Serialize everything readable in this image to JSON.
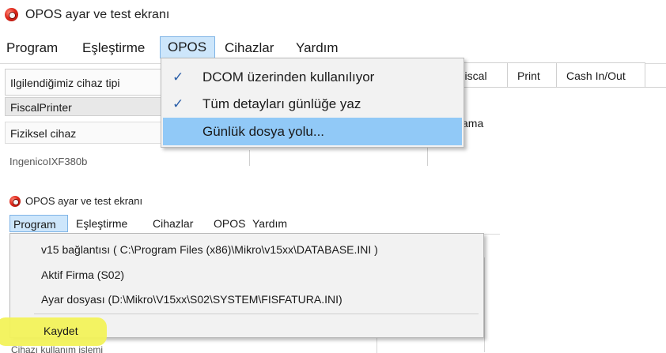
{
  "screenshot_top": {
    "window_title": "OPOS ayar ve test ekranı",
    "menubar": [
      "Program",
      "Eşleştirme",
      "OPOS",
      "Cihazlar",
      "Yardım"
    ],
    "open_menu": "OPOS",
    "dropdown": {
      "item1": "DCOM üzerinden kullanılıyor",
      "item1_checked": true,
      "item2": "Tüm detayları günlüğe yaz",
      "item2_checked": true,
      "item3": "Günlük dosya yolu...",
      "item3_highlighted": true,
      "check_glyph": "✓"
    },
    "left_panel": {
      "device_type_label": "Ilgilendiğimiz cihaz tipi",
      "device_type_value": "FiscalPrinter",
      "physical_device_label": "Fiziksel cihaz",
      "physical_device_value_cut": "IngenicoIXF380b"
    },
    "tabs": [
      "Fiscal",
      "Print",
      "Cash In/Out"
    ],
    "right_fragment": "ama"
  },
  "screenshot_bottom": {
    "window_title": "OPOS ayar ve test ekranı",
    "menubar": [
      "Program",
      "Eşleştirme",
      "Cihazlar",
      "OPOS",
      "Yardım"
    ],
    "open_menu": "Program",
    "dropdown": {
      "item1": "v15 bağlantısı ( C:\\Program Files (x86)\\Mikro\\v15xx\\DATABASE.INI )",
      "item2": "Aktif Firma (S02)",
      "item3": "Ayar dosyası (D:\\Mikro\\V15xx\\S02\\SYSTEM\\FISFATURA.INI)",
      "item4": "Kaydet"
    },
    "cut_label": "Cihazı kullanım işlemi"
  },
  "colors": {
    "menu_highlight": "#91c9f7",
    "menubar_active": "#cde6fb",
    "check_color": "#2b5fa8",
    "annotation_highlight": "#f2f25a"
  }
}
